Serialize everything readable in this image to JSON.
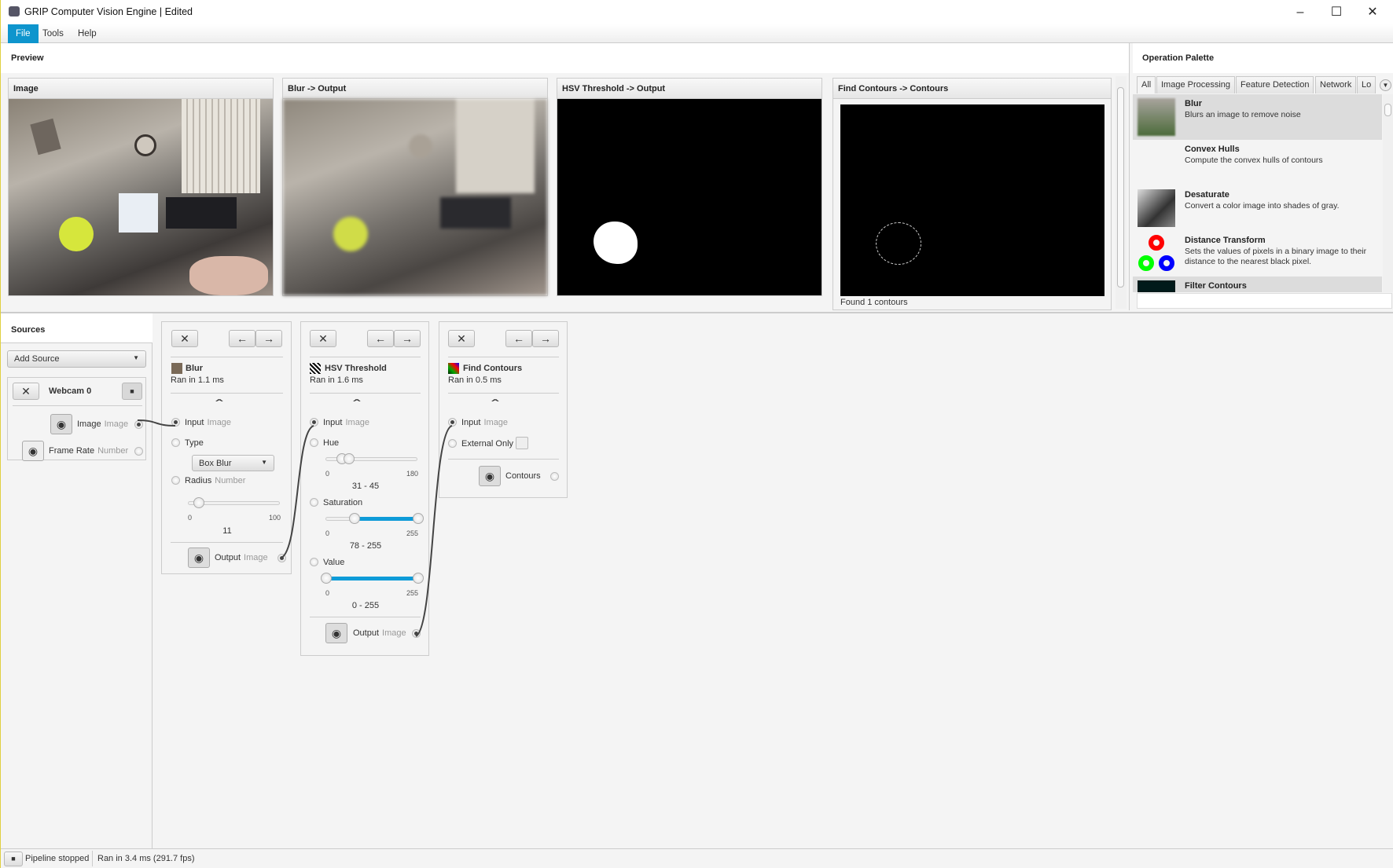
{
  "window": {
    "title": "GRIP Computer Vision Engine | Edited",
    "controls": [
      "minimize",
      "maximize",
      "close"
    ]
  },
  "menu": [
    "File",
    "Tools",
    "Help"
  ],
  "preview": {
    "title": "Preview",
    "cards": [
      {
        "title": "Image"
      },
      {
        "title": "Blur -> Output"
      },
      {
        "title": "HSV Threshold -> Output"
      },
      {
        "title": "Find Contours -> Contours",
        "footer": "Found 1 contours"
      }
    ]
  },
  "palette": {
    "title": "Operation Palette",
    "tabs": [
      "All",
      "Image Processing",
      "Feature Detection",
      "Network",
      "Lo"
    ],
    "operations": [
      {
        "name": "Blur",
        "description": "Blurs an image to remove noise"
      },
      {
        "name": "Convex Hulls",
        "description": "Compute the convex hulls of contours"
      },
      {
        "name": "Desaturate",
        "description": "Convert a color image into shades of gray."
      },
      {
        "name": "Distance Transform",
        "description": "Sets the values of pixels in a binary image to their distance to the nearest black pixel."
      },
      {
        "name": "Filter Contours",
        "description": ""
      }
    ],
    "search_value": ""
  },
  "sources": {
    "title": "Sources",
    "add_source": "Add Source",
    "source": {
      "name": "Webcam 0",
      "outputs": [
        {
          "name": "Image",
          "type": "Image"
        },
        {
          "name": "Frame Rate",
          "type": "Number"
        }
      ]
    }
  },
  "steps": {
    "blur": {
      "name": "Blur",
      "time": "Ran in 1.1 ms",
      "input": {
        "name": "Input",
        "type": "Image"
      },
      "type_label": "Type",
      "type_value": "Box Blur",
      "radius": {
        "name": "Radius",
        "type": "Number",
        "min": "0",
        "max": "100",
        "value": "11",
        "fraction": 0.11
      },
      "output": {
        "name": "Output",
        "type": "Image"
      }
    },
    "hsv": {
      "name": "HSV Threshold",
      "time": "Ran in 1.6 ms",
      "input": {
        "name": "Input",
        "type": "Image"
      },
      "hue": {
        "name": "Hue",
        "min": "0",
        "max": "180",
        "value": "31 - 45",
        "low": 31,
        "high": 45,
        "range": 180
      },
      "saturation": {
        "name": "Saturation",
        "min": "0",
        "max": "255",
        "value": "78 - 255",
        "low": 78,
        "high": 255,
        "range": 255
      },
      "value": {
        "name": "Value",
        "min": "0",
        "max": "255",
        "value": "0 - 255",
        "low": 0,
        "high": 255,
        "range": 255
      },
      "output": {
        "name": "Output",
        "type": "Image"
      }
    },
    "contours": {
      "name": "Find Contours",
      "time": "Ran in 0.5 ms",
      "input": {
        "name": "Input",
        "type": "Image"
      },
      "external_only": "External Only",
      "output": {
        "name": "Contours"
      }
    }
  },
  "status": {
    "pipeline": "Pipeline stopped",
    "timing": "Ran in 3.4 ms (291.7 fps)"
  },
  "colors": {
    "accent": "#0e95cd",
    "slider_fill": "#0e9bd8"
  }
}
